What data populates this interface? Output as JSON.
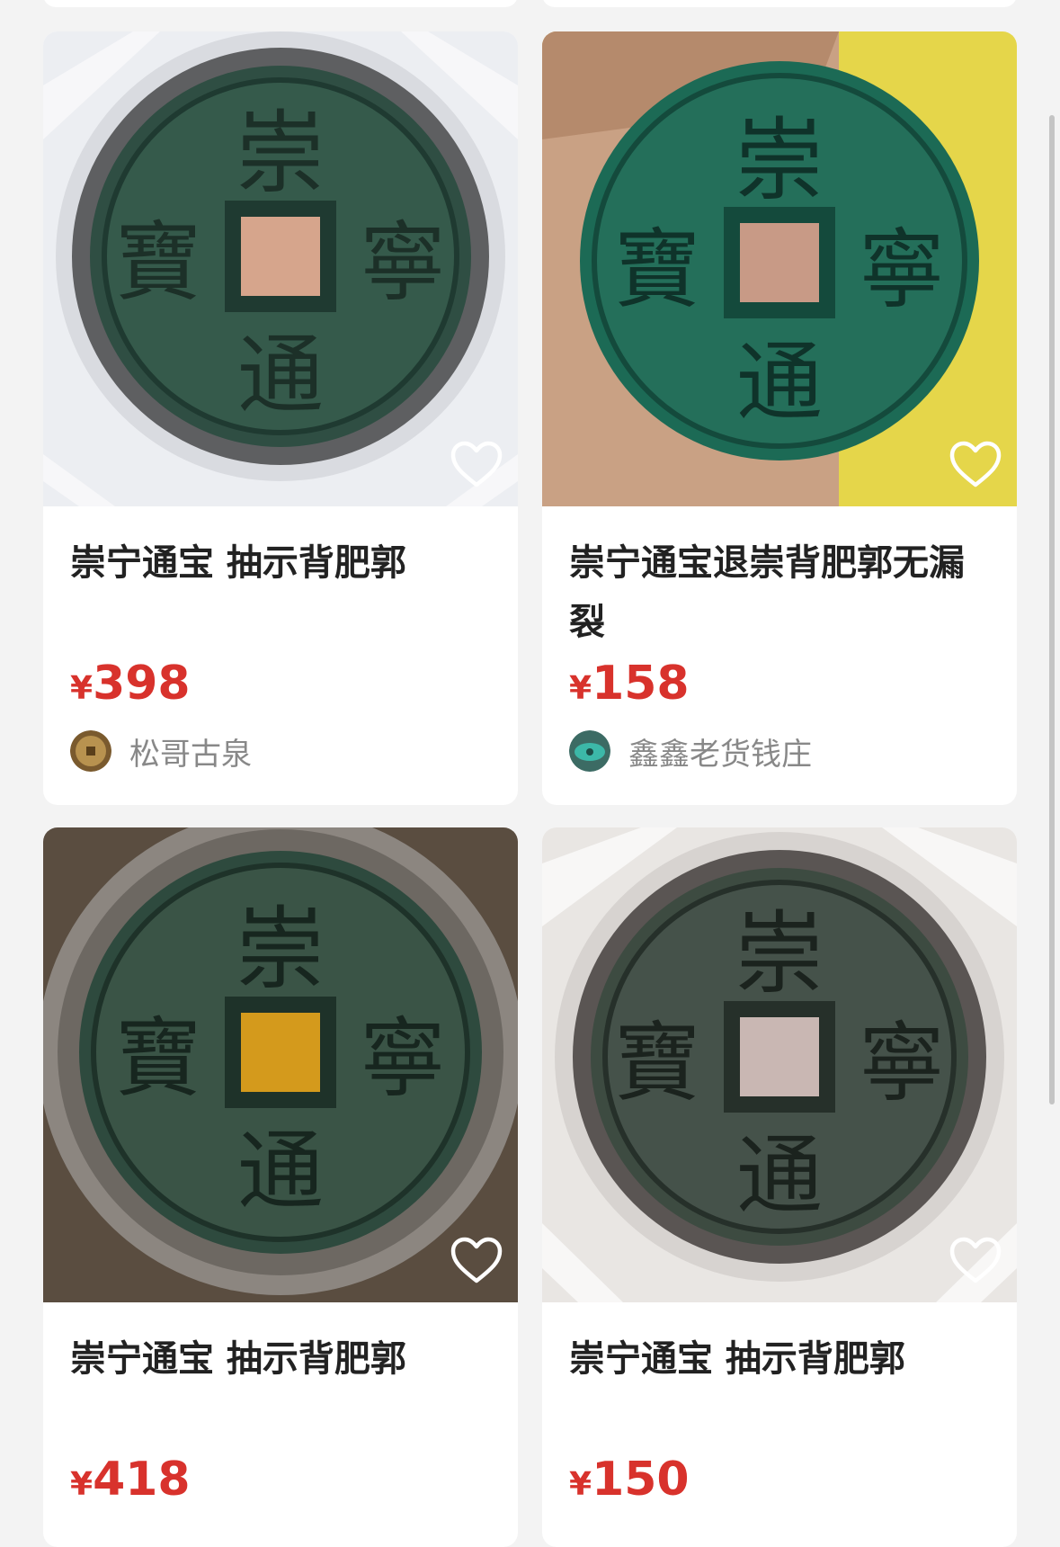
{
  "listings": [
    {
      "title": "崇宁通宝 抽示背肥郭",
      "currency": "¥",
      "price": "398",
      "seller": "松哥古泉",
      "avatar": "coin-avatar"
    },
    {
      "title": "崇宁通宝退崇背肥郭无漏裂",
      "currency": "¥",
      "price": "158",
      "seller": "鑫鑫老货钱庄",
      "avatar": "jade-avatar"
    },
    {
      "title": "崇宁通宝 抽示背肥郭",
      "currency": "¥",
      "price": "418",
      "seller": "",
      "avatar": ""
    },
    {
      "title": "崇宁通宝 抽示背肥郭",
      "currency": "¥",
      "price": "150",
      "seller": "",
      "avatar": ""
    }
  ],
  "coin_inscription": {
    "top": "崇",
    "right": "寧",
    "bottom": "通",
    "left": "寶"
  },
  "colors": {
    "price": "#d8322c",
    "background": "#f3f3f3",
    "card": "#ffffff",
    "patina": "#2f5a48"
  }
}
